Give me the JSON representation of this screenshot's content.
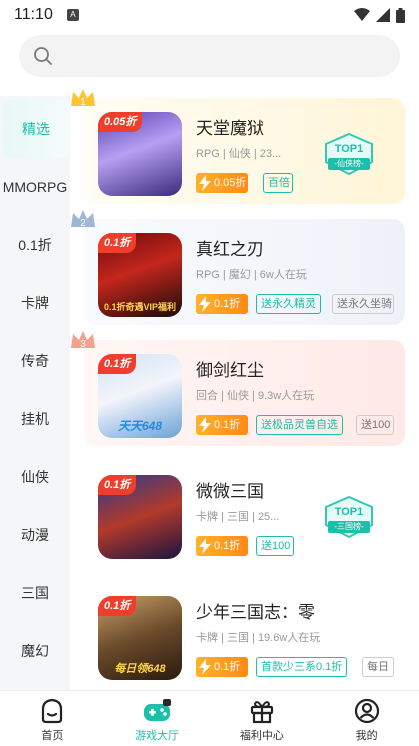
{
  "status_bar": {
    "time": "11:10",
    "sim_label": "A"
  },
  "search": {
    "placeholder": ""
  },
  "sidebar": {
    "items": [
      {
        "label": "精选"
      },
      {
        "label": "MMORPG"
      },
      {
        "label": "0.1折"
      },
      {
        "label": "卡牌"
      },
      {
        "label": "传奇"
      },
      {
        "label": "挂机"
      },
      {
        "label": "仙侠"
      },
      {
        "label": "动漫"
      },
      {
        "label": "三国"
      },
      {
        "label": "魔幻"
      }
    ]
  },
  "games": [
    {
      "rank": "1",
      "discount_badge": "0.05折",
      "name": "天堂魔狱",
      "meta": "RPG | 仙侠 | 23...",
      "price": "0.05折",
      "tags": [
        "百倍"
      ],
      "top_badge": {
        "title": "TOP1",
        "sub": "-仙侠榜-"
      },
      "cover_caption": ""
    },
    {
      "rank": "2",
      "discount_badge": "0.1折",
      "name": "真红之刃",
      "meta": "RPG | 魔幻 | 6w人在玩",
      "price": "0.1折",
      "tags": [
        "送永久精灵",
        "送永久坐骑"
      ],
      "cover_caption": "0.1折奇遇VIP福利"
    },
    {
      "rank": "3",
      "discount_badge": "0.1折",
      "name": "御剑红尘",
      "meta": "回合 | 仙侠 | 9.3w人在玩",
      "price": "0.1折",
      "tags": [
        "送极品灵兽自选",
        "送100"
      ],
      "cover_caption": "天天648"
    },
    {
      "rank": "",
      "discount_badge": "0.1折",
      "name": "微微三国",
      "meta": "卡牌 | 三国 | 25...",
      "price": "0.1折",
      "tags": [
        "送100"
      ],
      "top_badge": {
        "title": "TOP1",
        "sub": "-三国榜-"
      },
      "cover_caption": ""
    },
    {
      "rank": "",
      "discount_badge": "0.1折",
      "name": "少年三国志：零",
      "meta": "卡牌 | 三国 | 19.6w人在玩",
      "price": "0.1折",
      "tags": [
        "首款少三系0.1折",
        "每日"
      ],
      "cover_caption": "每日领648"
    }
  ],
  "tabbar": {
    "items": [
      {
        "label": "首页",
        "icon": "home-icon"
      },
      {
        "label": "游戏大厅",
        "icon": "gamepad-icon"
      },
      {
        "label": "福利中心",
        "icon": "gift-icon"
      },
      {
        "label": "我的",
        "icon": "profile-icon"
      }
    ]
  },
  "colors": {
    "accent": "#1cbfa7",
    "price_orange": "#ff8a16",
    "discount_red": "#ef3e2b"
  }
}
